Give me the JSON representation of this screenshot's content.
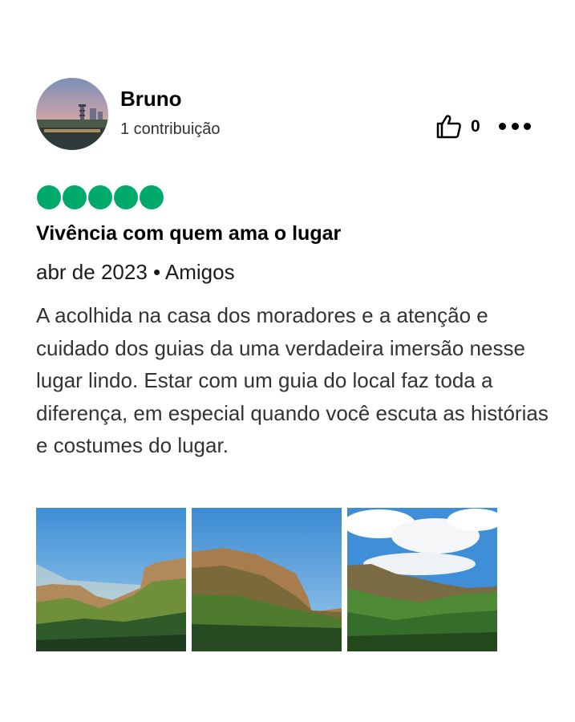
{
  "review": {
    "user": {
      "name": "Bruno",
      "contributions": "1 contribuição",
      "avatar_icon": "user-avatar-photo"
    },
    "likes": {
      "icon": "thumbs-up-icon",
      "count": "0"
    },
    "more_icon": "more-options-icon",
    "rating": {
      "value": 5,
      "max": 5,
      "color": "#00aa6c"
    },
    "title": "Vivência com quem ama o lugar",
    "meta": "abr de 2023 • Amigos",
    "body": "A acolhida na casa dos moradores e a atenção e cuidado dos guias da uma verdadeira imersão nesse lugar lindo. Estar com um guia do local faz toda a diferença, em especial quando você escuta as histórias e costumes do lugar."
  },
  "photos": [
    {
      "alt": "Paisagem de morros",
      "icon": "landscape-photo"
    },
    {
      "alt": "Paisagem de morros",
      "icon": "landscape-photo"
    },
    {
      "alt": "Paisagem de vale",
      "icon": "landscape-photo"
    }
  ]
}
